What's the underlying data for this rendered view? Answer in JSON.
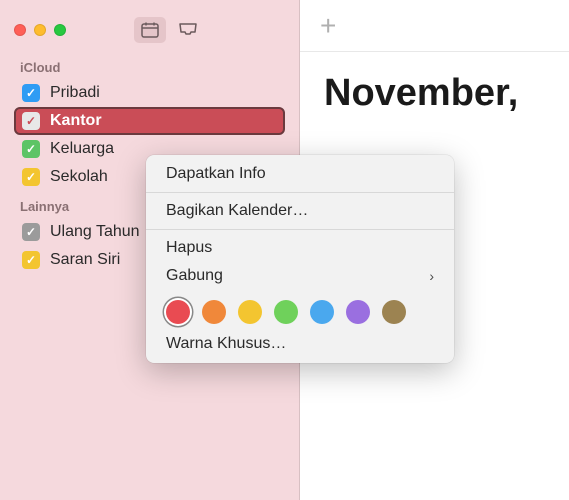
{
  "window": {
    "traffic_lights": [
      "close",
      "minimize",
      "zoom"
    ]
  },
  "sidebar": {
    "sections": [
      {
        "id": "icloud",
        "label": "iCloud",
        "items": [
          {
            "label": "Pribadi",
            "color": "#2f9cf4",
            "checked": true,
            "selected": false
          },
          {
            "label": "Kantor",
            "color": "#e8e8e8",
            "checkColor": "#ca4d57",
            "checked": true,
            "selected": true
          },
          {
            "label": "Keluarga",
            "color": "#5dc466",
            "checked": true,
            "selected": false
          },
          {
            "label": "Sekolah",
            "color": "#f3c530",
            "checked": true,
            "selected": false
          }
        ]
      },
      {
        "id": "lainnya",
        "label": "Lainnya",
        "items": [
          {
            "label": "Ulang Tahun",
            "color": "#9b9b9b",
            "checked": true,
            "selected": false
          },
          {
            "label": "Saran Siri",
            "color": "#f3c530",
            "checked": true,
            "selected": false
          }
        ]
      }
    ]
  },
  "main": {
    "title": "November,"
  },
  "context_menu": {
    "items": [
      {
        "type": "item",
        "label": "Dapatkan Info",
        "id": "get-info"
      },
      {
        "type": "separator"
      },
      {
        "type": "item",
        "label": "Bagikan Kalender…",
        "id": "share-calendar"
      },
      {
        "type": "separator"
      },
      {
        "type": "item",
        "label": "Hapus",
        "id": "delete"
      },
      {
        "type": "item",
        "label": "Gabung",
        "id": "merge",
        "submenu": true
      },
      {
        "type": "colors"
      },
      {
        "type": "item",
        "label": "Warna Khusus…",
        "id": "custom-color"
      }
    ],
    "colors": [
      {
        "hex": "#e94b52",
        "selected": true,
        "name": "red"
      },
      {
        "hex": "#f0883a",
        "selected": false,
        "name": "orange"
      },
      {
        "hex": "#f3c530",
        "selected": false,
        "name": "yellow"
      },
      {
        "hex": "#6fd15b",
        "selected": false,
        "name": "green"
      },
      {
        "hex": "#4aa8ee",
        "selected": false,
        "name": "blue"
      },
      {
        "hex": "#9a6fe0",
        "selected": false,
        "name": "purple"
      },
      {
        "hex": "#9c8351",
        "selected": false,
        "name": "brown"
      }
    ]
  }
}
